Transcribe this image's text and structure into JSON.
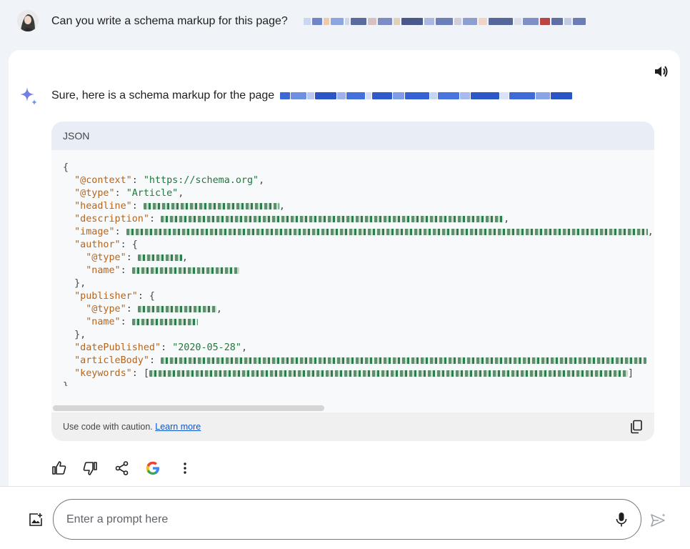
{
  "user": {
    "prompt": "Can you write a schema markup for this page?",
    "avatar_icon": "user-avatar"
  },
  "response": {
    "intro": "Sure, here is a schema markup for the page",
    "speaker_icon": "volume-icon",
    "logo_icon": "gemini-sparkle-icon"
  },
  "code": {
    "language": "JSON",
    "open_brace": "{",
    "close_brace": "}",
    "context_key": "\"@context\"",
    "context_val": "\"https://schema.org\"",
    "type_key": "\"@type\"",
    "type_val": "\"Article\"",
    "headline_key": "\"headline\"",
    "description_key": "\"description\"",
    "image_key": "\"image\"",
    "author_key": "\"author\"",
    "author_type_key": "\"@type\"",
    "author_name_key": "\"name\"",
    "publisher_key": "\"publisher\"",
    "publisher_type_key": "\"@type\"",
    "publisher_name_key": "\"name\"",
    "date_key": "\"datePublished\"",
    "date_val": "\"2020-05-28\"",
    "body_key": "\"articleBody\"",
    "keywords_key": "\"keywords\"",
    "caution_text": "Use code with caution.",
    "learn_more": "Learn more"
  },
  "actions": [
    "thumb-up-icon",
    "thumb-down-icon",
    "share-icon",
    "google-g-icon",
    "more-vert-icon"
  ],
  "input": {
    "placeholder": "Enter a prompt here"
  },
  "colors": {
    "page_bg": "#f0f4f9",
    "key": "#b5651d",
    "string": "#1e7a3c",
    "link": "#0b57d0"
  }
}
